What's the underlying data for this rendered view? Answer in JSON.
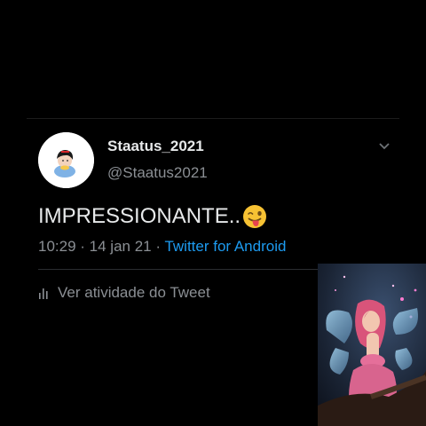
{
  "tweet": {
    "display_name": "Staatus_2021",
    "handle": "@Staatus2021",
    "text": "IMPRESSIONANTE..",
    "emoji": "winking-face-with-tongue",
    "time": "10:29",
    "date": "14 jan 21",
    "separator": "·",
    "source": "Twitter for Android",
    "activity_label": "Ver atividade do Tweet"
  },
  "icons": {
    "more": "chevron-down-icon",
    "activity": "bar-chart-icon",
    "avatar": "cartoon-avatar"
  },
  "colors": {
    "background": "#000000",
    "text_primary": "#e7e9ea",
    "text_secondary": "#8b8f94",
    "link": "#1d9bf0",
    "divider": "#2a2d30"
  }
}
